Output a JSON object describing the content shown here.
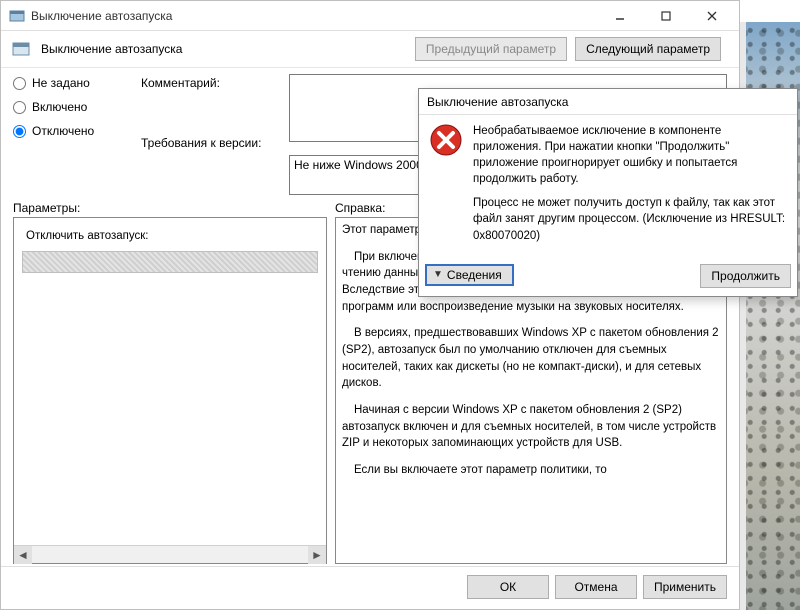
{
  "window": {
    "title": "Выключение автозапуска",
    "header_title": "Выключение автозапуска",
    "caption_minimize": "Minimize",
    "caption_maximize": "Maximize",
    "caption_close": "Close"
  },
  "nav": {
    "previous": "Предыдущий параметр",
    "next": "Следующий параметр"
  },
  "state": {
    "not_configured": "Не задано",
    "enabled": "Включено",
    "disabled": "Отключено",
    "selected": "disabled"
  },
  "fields": {
    "comment_label": "Комментарий:",
    "comment_value": "",
    "requirements_label": "Требования к версии:",
    "requirements_value": "Не ниже Windows 2000"
  },
  "sections": {
    "options_label": "Параметры:",
    "help_label": "Справка:"
  },
  "options_panel": {
    "subtitle": "Отключить автозапуск:"
  },
  "help": {
    "p1": "Этот параметр политики позволяет выключить функцию автозапуска.",
    "p2": "При включенном автоматическом запуске система приступает к чтению данных сразу же после обнаружения носителя в устройстве. Вследствие этого автоматически запускаются файлы установки программ или воспроизведение музыки на звуковых носителях.",
    "p3": "В версиях, предшествовавших Windows XP с пакетом обновления 2 (SP2), автозапуск был по умолчанию отключен для съемных носителей, таких как дискеты (но не компакт-диски), и для сетевых дисков.",
    "p4": "Начиная с версии Windows XP с пакетом обновления 2 (SP2) автозапуск включен и для съемных носителей, в том числе устройств ZIP и некоторых запоминающих устройств для USB.",
    "p5": "Если вы включаете этот параметр политики, то"
  },
  "footer": {
    "ok": "ОК",
    "cancel": "Отмена",
    "apply": "Применить"
  },
  "error_dialog": {
    "title": "Выключение автозапуска",
    "msg1": "Необрабатываемое исключение в компоненте приложения. При нажатии кнопки \"Продолжить\" приложение проигнорирует ошибку и попытается продолжить работу.",
    "msg2": "Процесс не может получить доступ к файлу, так как этот файл занят другим процессом. (Исключение из HRESULT: 0x80070020)",
    "details_label": "Сведения",
    "continue_label": "Продолжить"
  }
}
